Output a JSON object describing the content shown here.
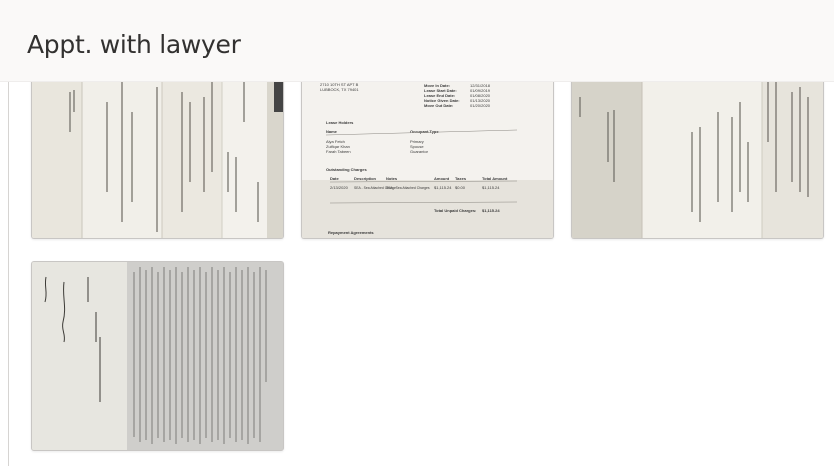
{
  "header": {
    "title": "Appt. with lawyer"
  },
  "photos": [
    {
      "label": "Rotated document photo 1"
    },
    {
      "label": "Lease ledger document photo",
      "address": [
        "2710 10TH ST APT B",
        "LUBBOCK, TX 79401"
      ],
      "dates": [
        {
          "label": "Move In Date:",
          "value": "12/31/2018"
        },
        {
          "label": "Lease Start Date:",
          "value": "01/09/2019"
        },
        {
          "label": "Lease End Date:",
          "value": "01/08/2020"
        },
        {
          "label": "Notice Given Date:",
          "value": "01/13/2020"
        },
        {
          "label": "Move Out Date:",
          "value": "01/20/2020"
        }
      ],
      "lease_holders_heading": "Lease Holders",
      "name_col": "Name",
      "occupant_type_col": "Occupant Type",
      "holders": [
        {
          "name": "Alya Fetch",
          "type": "Primary"
        },
        {
          "name": "Zulfiqar Khan",
          "type": "Spouse"
        },
        {
          "name": "Farah Tabeen",
          "type": "Guarantor"
        }
      ],
      "outstanding_heading": "Outstanding Charges",
      "charge_cols": [
        "Date",
        "Description",
        "Notes",
        "Amount",
        "Taxes",
        "Total Amount"
      ],
      "charge_row": [
        "2/13/2020",
        "SEA - Sea Attached Charge",
        "SEA - Sea Attached Charges",
        "$1,115.24",
        "$0.00",
        "$1,115.24"
      ],
      "total_label": "Total Unpaid Charges:",
      "total_value": "$1,115.24",
      "repayment_heading": "Repayment Agreements"
    },
    {
      "label": "Rotated document photo 3"
    },
    {
      "label": "Signed document photo 4"
    }
  ]
}
